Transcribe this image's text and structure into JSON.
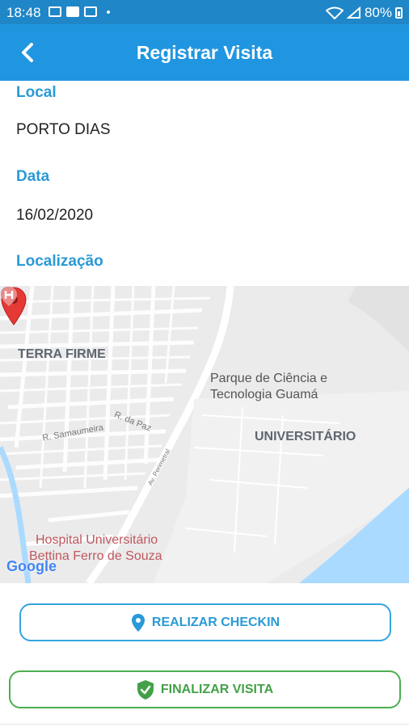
{
  "status_bar": {
    "time": "18:48",
    "icons": [
      "gallery-icon",
      "youtube-icon",
      "twitch-icon"
    ],
    "battery": "80%"
  },
  "app_bar": {
    "title": "Registrar Visita",
    "back_icon": "chevron-left-icon"
  },
  "form": {
    "local_label": "Local",
    "local_value": "PORTO DIAS",
    "data_label": "Data",
    "data_value": "16/02/2020",
    "localizacao_label": "Localização"
  },
  "map": {
    "labels": {
      "terra_firme": "TERRA FIRME",
      "park_line1": "Parque de Ciência e",
      "park_line2": "Tecnologia Guamá",
      "universitario": "UNIVERSITÁRIO",
      "samaumeira": "R. Samaumeira",
      "da_paz": "R. da Paz",
      "perimetral": "Av. Perimetral",
      "hospital_line1": "Hospital Universitário",
      "hospital_line2": "Bettina Ferro de Souza"
    },
    "google": "Google"
  },
  "actions": {
    "checkin_label": "REALIZAR CHECKIN",
    "finalizar_label": "FINALIZAR VISITA"
  },
  "colors": {
    "status_bar": "#1f86c7",
    "app_bar": "#2196e0",
    "label_blue": "#2a9ad6",
    "green": "#43a047"
  }
}
